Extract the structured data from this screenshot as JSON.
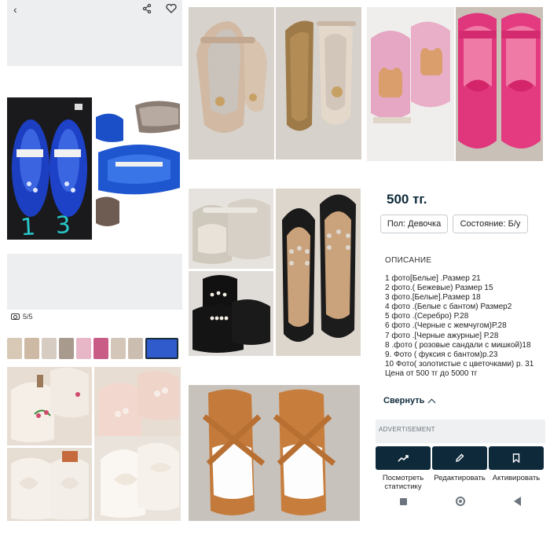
{
  "listing": {
    "photo_counter": "5/5",
    "handwritten_note": "1 3 р'"
  },
  "info": {
    "price": "500 тг.",
    "chips": [
      "Пол: Девочка",
      "Состояние: Б/у"
    ],
    "description_heading": "ОПИСАНИЕ",
    "description_lines": [
      "1 фото[Белые] .Размер 21",
      "2 фото.( Бежевые) Размер 15",
      "3 фото.[Белые].Размер 18",
      "4 фото .(Белые с бантом) Размер2",
      "5 фото .(Серебро) Р.28",
      "6 фото .(Черные с жемчугом)Р.28",
      "7 фото .[Черные ажурные] Р.28",
      "8 .фото ( розовые сандали с мишкой)18",
      "9. Фото ( фуксия с бантом)р.23",
      "10 Фото( золотистые с цветочками) р. 31",
      "Цена от 500 тг до 5000 тг"
    ],
    "collapse_label": "Свернуть",
    "ad_label": "ADVERTISEMENT",
    "actions": [
      {
        "label": "Посмотреть статистику",
        "icon": "trend-icon"
      },
      {
        "label": "Редактировать",
        "icon": "pencil-icon"
      },
      {
        "label": "Активировать",
        "icon": "bookmark-icon"
      }
    ]
  },
  "colors": {
    "brand_dark": "#0e2a3a",
    "handwriting": "#27c7c9",
    "panel_gray": "#eceef0"
  }
}
